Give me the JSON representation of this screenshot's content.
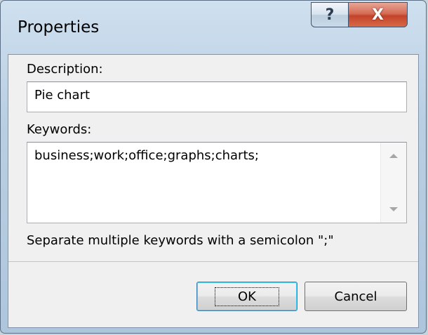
{
  "window": {
    "title": "Properties",
    "help_glyph": "?",
    "close_glyph": "X"
  },
  "description": {
    "label": "Description:",
    "value": "Pie chart"
  },
  "keywords": {
    "label": "Keywords:",
    "value": "business;work;office;graphs;charts;",
    "hint": "Separate multiple keywords with a semicolon \";\""
  },
  "buttons": {
    "ok_label": "OK",
    "cancel_label": "Cancel"
  },
  "icons": [
    "help-icon",
    "close-icon",
    "scroll-up-arrow-icon",
    "scroll-down-arrow-icon"
  ]
}
